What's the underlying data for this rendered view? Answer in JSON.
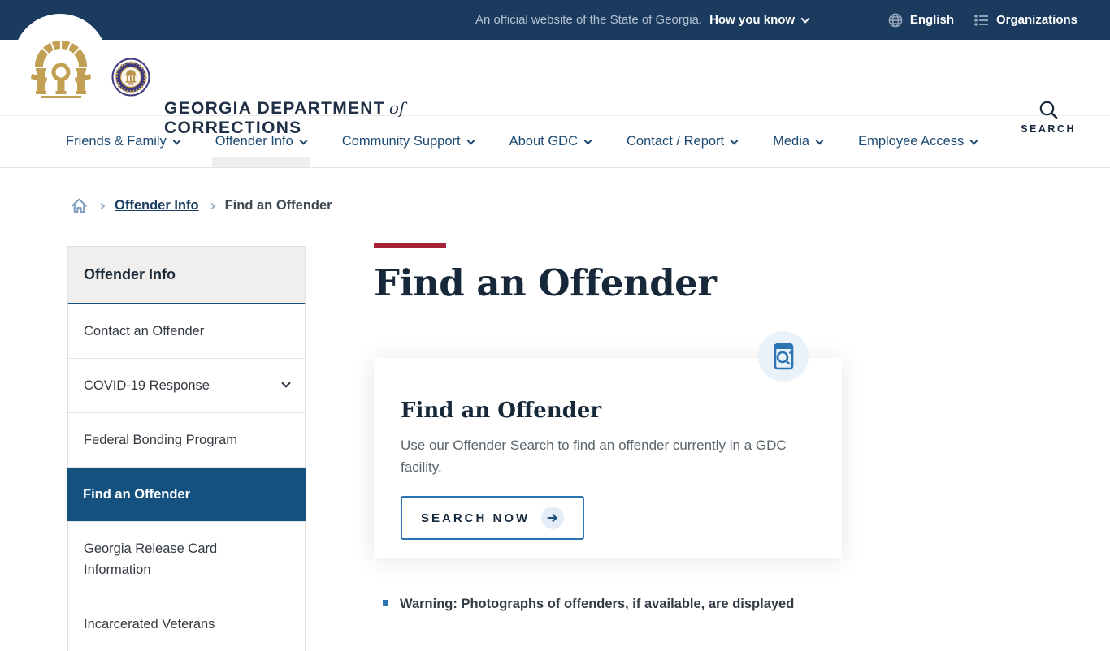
{
  "topbar": {
    "official_text": "An official website of the State of Georgia.",
    "how_you_know_label": "How you know",
    "language_label": "English",
    "organizations_label": "Organizations"
  },
  "header": {
    "agency_name_line1": "GEORGIA DEPARTMENT",
    "agency_name_connector": "of",
    "agency_name_line2": "CORRECTIONS",
    "search_label": "SEARCH"
  },
  "nav": {
    "items": [
      {
        "label": "Friends & Family",
        "active": false
      },
      {
        "label": "Offender Info",
        "active": true
      },
      {
        "label": "Community Support",
        "active": false
      },
      {
        "label": "About GDC",
        "active": false
      },
      {
        "label": "Contact / Report",
        "active": false
      },
      {
        "label": "Media",
        "active": false
      },
      {
        "label": "Employee Access",
        "active": false
      }
    ]
  },
  "breadcrumb": {
    "link": "Offender Info",
    "current": "Find an Offender"
  },
  "sidebar": {
    "title": "Offender Info",
    "items": [
      {
        "label": "Contact an Offender",
        "active": false,
        "expandable": false
      },
      {
        "label": "COVID-19 Response",
        "active": false,
        "expandable": true
      },
      {
        "label": "Federal Bonding Program",
        "active": false,
        "expandable": false
      },
      {
        "label": "Find an Offender",
        "active": true,
        "expandable": false
      },
      {
        "label": "Georgia Release Card Information",
        "active": false,
        "expandable": false
      },
      {
        "label": "Incarcerated Veterans",
        "active": false,
        "expandable": false,
        "clipped_by_viewport": true
      }
    ]
  },
  "main": {
    "page_title": "Find an Offender",
    "card": {
      "title": "Find an Offender",
      "description": "Use our Offender Search to find an offender currently in a GDC facility.",
      "button_label": "SEARCH NOW"
    },
    "warning_item": "Warning: Photographs of offenders, if available, are displayed"
  },
  "icons": {
    "badge": "document-search-icon",
    "logo": "georgia-arch-logo",
    "seal": "gdc-seal"
  },
  "colors": {
    "topbar_bg": "#1a3a5e",
    "accent_red": "#a32035",
    "link_blue": "#1d4a73",
    "active_item_bg": "#15517e",
    "button_border_blue": "#2d74b5",
    "badge_bg": "#e9f1f9",
    "gold": "#c2a053"
  }
}
